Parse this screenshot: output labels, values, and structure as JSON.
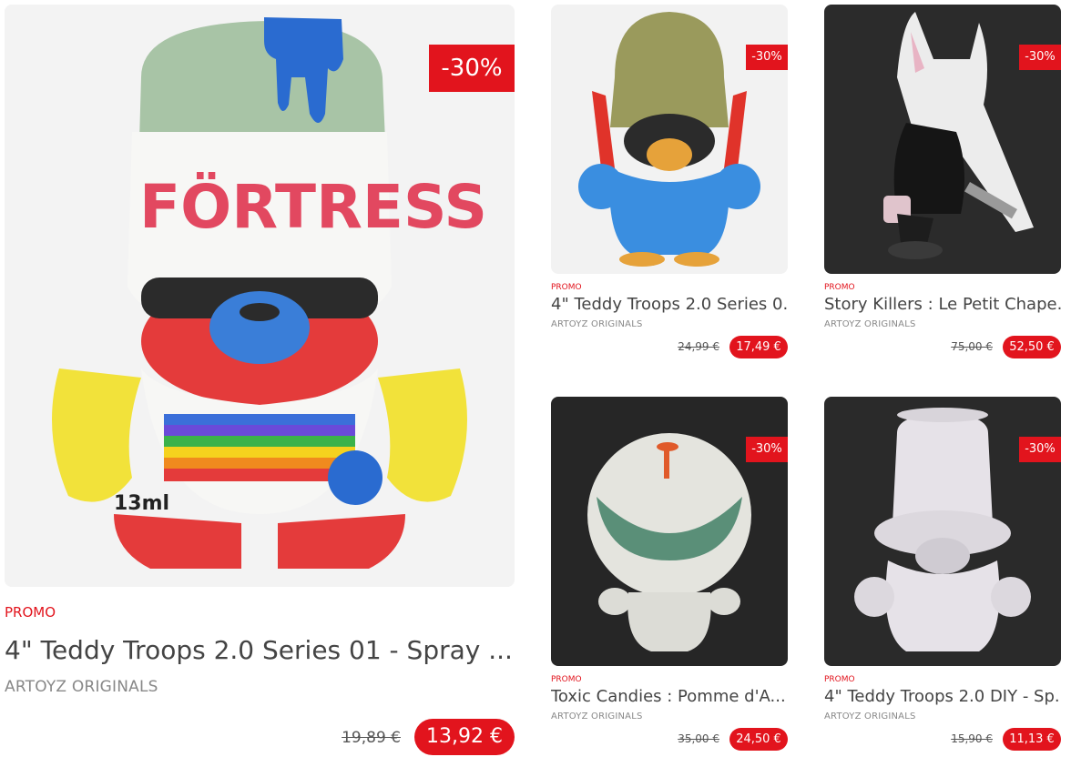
{
  "products": [
    {
      "badge": "-30%",
      "promo_label": "PROMO",
      "title": "4\" Teddy Troops 2.0 Series 01 - Spray ...",
      "brand": "ARTOYZ ORIGINALS",
      "old_price": "19,89 €",
      "price": "13,92 €"
    },
    {
      "badge": "-30%",
      "promo_label": "PROMO",
      "title": "4\" Teddy Troops 2.0 Series 0...",
      "brand": "ARTOYZ ORIGINALS",
      "old_price": "24,99 €",
      "price": "17,49 €"
    },
    {
      "badge": "-30%",
      "promo_label": "PROMO",
      "title": "Story Killers : Le Petit Chape...",
      "brand": "ARTOYZ ORIGINALS",
      "old_price": "75,00 €",
      "price": "52,50 €"
    },
    {
      "badge": "-30%",
      "promo_label": "PROMO",
      "title": "Toxic Candies : Pomme d'A...",
      "brand": "ARTOYZ ORIGINALS",
      "old_price": "35,00 €",
      "price": "24,50 €"
    },
    {
      "badge": "-30%",
      "promo_label": "PROMO",
      "title": "4\" Teddy Troops 2.0 DIY - Sp...",
      "brand": "ARTOYZ ORIGINALS",
      "old_price": "15,90 €",
      "price": "11,13 €"
    }
  ],
  "image_text": {
    "fortress": "FÖRTRESS",
    "label_13ml": "13ml"
  },
  "colors": {
    "accent_red": "#e2141d",
    "brand_gray": "#888888"
  }
}
